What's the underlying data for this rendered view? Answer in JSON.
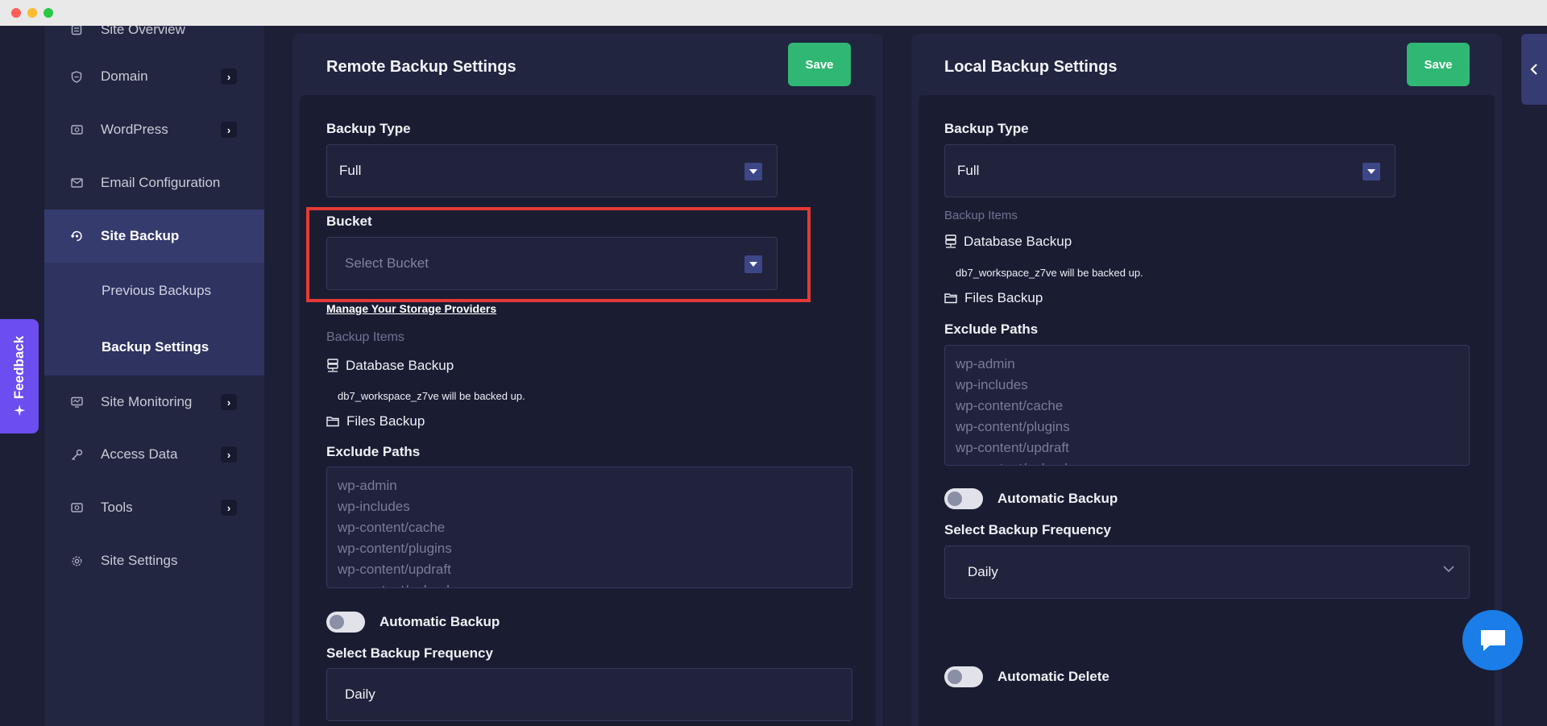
{
  "sidebar": {
    "items": [
      {
        "label": "Site Overview",
        "icon": "overview-icon",
        "chevron": false
      },
      {
        "label": "Domain",
        "icon": "shield-icon",
        "chevron": true
      },
      {
        "label": "WordPress",
        "icon": "wordpress-icon",
        "chevron": true
      },
      {
        "label": "Email Configuration",
        "icon": "mail-icon",
        "chevron": false
      },
      {
        "label": "Site Backup",
        "icon": "backup-icon",
        "chevron": false,
        "active": true
      },
      {
        "label": "Site Monitoring",
        "icon": "monitor-icon",
        "chevron": true
      },
      {
        "label": "Access Data",
        "icon": "key-icon",
        "chevron": true
      },
      {
        "label": "Tools",
        "icon": "tools-icon",
        "chevron": true
      },
      {
        "label": "Site Settings",
        "icon": "gear-icon",
        "chevron": false
      }
    ],
    "sub_items": [
      {
        "label": "Previous Backups"
      },
      {
        "label": "Backup Settings",
        "current": true
      }
    ]
  },
  "feedback": {
    "label": "Feedback"
  },
  "remote": {
    "title": "Remote Backup Settings",
    "save_label": "Save",
    "backup_type_label": "Backup Type",
    "backup_type_value": "Full",
    "bucket_label": "Bucket",
    "bucket_placeholder": "Select Bucket",
    "manage_link": "Manage Your Storage Providers",
    "backup_items_label": "Backup Items",
    "database_backup": "Database Backup",
    "database_note": "db7_workspace_z7ve will be backed up.",
    "files_backup": "Files Backup",
    "exclude_paths_label": "Exclude Paths",
    "exclude_paths": [
      "wp-admin",
      "wp-includes",
      "wp-content/cache",
      "wp-content/plugins",
      "wp-content/updraft",
      "wp-content/upload"
    ],
    "automatic_backup": "Automatic Backup",
    "frequency_label": "Select Backup Frequency",
    "frequency_value": "Daily"
  },
  "local": {
    "title": "Local Backup Settings",
    "save_label": "Save",
    "backup_type_label": "Backup Type",
    "backup_type_value": "Full",
    "backup_items_label": "Backup Items",
    "database_backup": "Database Backup",
    "database_note": "db7_workspace_z7ve will be backed up.",
    "files_backup": "Files Backup",
    "exclude_paths_label": "Exclude Paths",
    "exclude_paths": [
      "wp-admin",
      "wp-includes",
      "wp-content/cache",
      "wp-content/plugins",
      "wp-content/updraft",
      "wp-content/upload"
    ],
    "automatic_backup": "Automatic Backup",
    "frequency_label": "Select Backup Frequency",
    "frequency_value": "Daily",
    "automatic_delete": "Automatic Delete"
  },
  "colors": {
    "accent_green": "#2fb773",
    "active_nav": "#363b6e",
    "highlight_red": "#e53935",
    "feedback_purple": "#6b4df0",
    "chat_blue": "#1a7de8"
  }
}
